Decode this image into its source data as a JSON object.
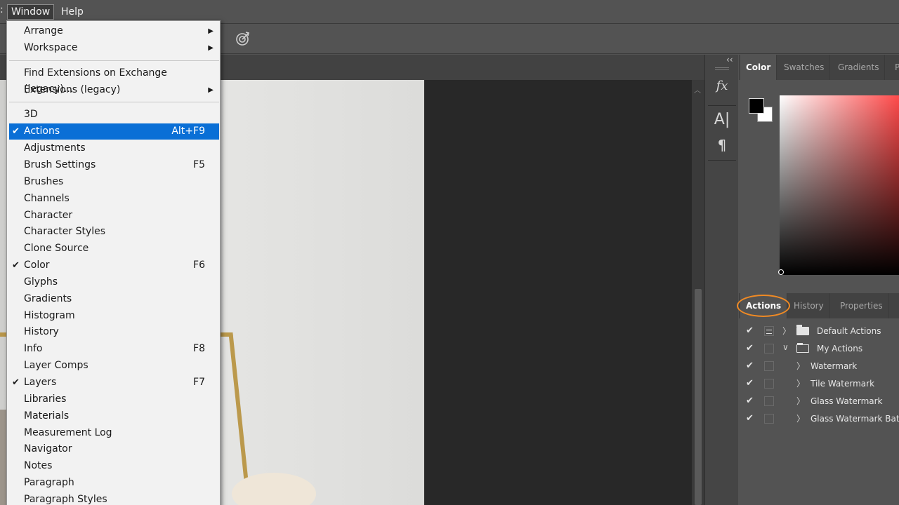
{
  "menubar": {
    "window_label": "Window",
    "help_label": "Help"
  },
  "window_menu": {
    "group1": [
      {
        "label": "Arrange",
        "submenu": true
      },
      {
        "label": "Workspace",
        "submenu": true
      }
    ],
    "group2": [
      {
        "label": "Find Extensions on Exchange (legacy)...",
        "submenu": false
      },
      {
        "label": "Extensions (legacy)",
        "submenu": true
      }
    ],
    "group3": [
      {
        "label": "3D",
        "checked": false,
        "shortcut": ""
      },
      {
        "label": "Actions",
        "checked": true,
        "shortcut": "Alt+F9",
        "highlighted": true
      },
      {
        "label": "Adjustments",
        "checked": false,
        "shortcut": ""
      },
      {
        "label": "Brush Settings",
        "checked": false,
        "shortcut": "F5"
      },
      {
        "label": "Brushes",
        "checked": false,
        "shortcut": ""
      },
      {
        "label": "Channels",
        "checked": false,
        "shortcut": ""
      },
      {
        "label": "Character",
        "checked": false,
        "shortcut": ""
      },
      {
        "label": "Character Styles",
        "checked": false,
        "shortcut": ""
      },
      {
        "label": "Clone Source",
        "checked": false,
        "shortcut": ""
      },
      {
        "label": "Color",
        "checked": true,
        "shortcut": "F6"
      },
      {
        "label": "Glyphs",
        "checked": false,
        "shortcut": ""
      },
      {
        "label": "Gradients",
        "checked": false,
        "shortcut": ""
      },
      {
        "label": "Histogram",
        "checked": false,
        "shortcut": ""
      },
      {
        "label": "History",
        "checked": false,
        "shortcut": ""
      },
      {
        "label": "Info",
        "checked": false,
        "shortcut": "F8"
      },
      {
        "label": "Layer Comps",
        "checked": false,
        "shortcut": ""
      },
      {
        "label": "Layers",
        "checked": true,
        "shortcut": "F7"
      },
      {
        "label": "Libraries",
        "checked": false,
        "shortcut": ""
      },
      {
        "label": "Materials",
        "checked": false,
        "shortcut": ""
      },
      {
        "label": "Measurement Log",
        "checked": false,
        "shortcut": ""
      },
      {
        "label": "Navigator",
        "checked": false,
        "shortcut": ""
      },
      {
        "label": "Notes",
        "checked": false,
        "shortcut": ""
      },
      {
        "label": "Paragraph",
        "checked": false,
        "shortcut": ""
      },
      {
        "label": "Paragraph Styles",
        "checked": false,
        "shortcut": ""
      }
    ],
    "check_glyph": "✔",
    "arrow_glyph": "▶"
  },
  "dock": {
    "fx_label": "fx",
    "char_label": "A|",
    "para_label": "¶",
    "collapse_label": "‹‹"
  },
  "color_panel": {
    "tabs": [
      "Color",
      "Swatches",
      "Gradients",
      "P"
    ],
    "foreground_color": "#000000",
    "background_color": "#ffffff",
    "hue_color": "#ff4a4a"
  },
  "actions_panel": {
    "tabs": [
      "Actions",
      "History",
      "Properties"
    ],
    "check_glyph": "✔",
    "collapsed_glyph": "〉",
    "expanded_glyph": "∨",
    "items": [
      {
        "label": "Default Actions",
        "type": "set",
        "expanded": false,
        "dialog": true
      },
      {
        "label": "My Actions",
        "type": "set",
        "expanded": true,
        "dialog": false
      },
      {
        "label": "Watermark",
        "type": "action",
        "expanded": false,
        "dialog": false
      },
      {
        "label": "Tile Watermark",
        "type": "action",
        "expanded": false,
        "dialog": false
      },
      {
        "label": "Glass Watermark",
        "type": "action",
        "expanded": false,
        "dialog": false
      },
      {
        "label": "Glass Watermark Batch",
        "type": "action",
        "expanded": false,
        "dialog": false
      }
    ]
  },
  "colors": {
    "highlight": "#0a6fd6",
    "annotation_ring": "#f08a24"
  }
}
